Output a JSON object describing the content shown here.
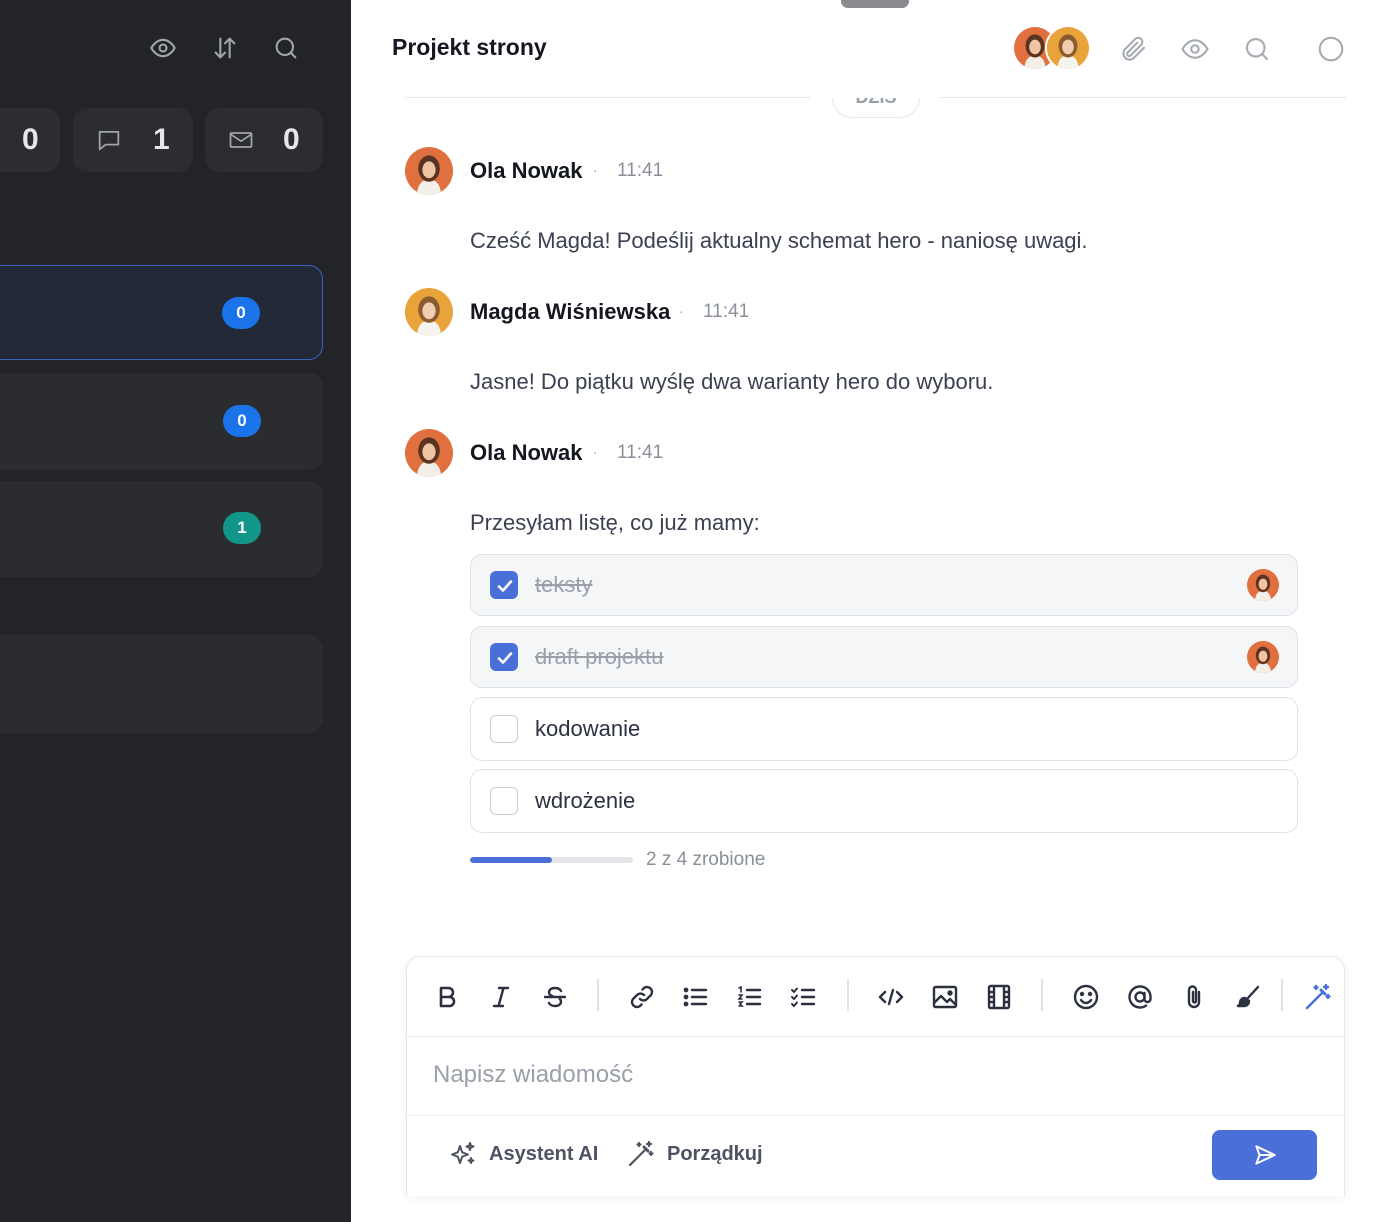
{
  "left_panel": {
    "counters": [
      {
        "icon": "unknown-icon",
        "value": "0"
      },
      {
        "icon": "comment-icon",
        "value": "1"
      },
      {
        "icon": "mail-icon",
        "value": "0"
      }
    ],
    "items": [
      {
        "badge": "0",
        "badge_color": "#1a73e8",
        "active": true
      },
      {
        "badge": "0",
        "badge_color": "#1a73e8",
        "active": false
      },
      {
        "badge": "1",
        "badge_color": "#12968a",
        "active": false
      },
      {
        "badge": "",
        "active": false
      }
    ]
  },
  "chat": {
    "title": "Projekt strony",
    "day_label": "DZIŚ",
    "messages": [
      {
        "author": "Ola Nowak",
        "time": "11:41",
        "text": "Cześć Magda! Podeślij aktualny schemat hero - naniosę uwagi."
      },
      {
        "author": "Magda Wiśniewska",
        "time": "11:41",
        "text": "Jasne! Do piątku wyślę dwa warianty hero do wyboru."
      },
      {
        "author": "Ola Nowak",
        "time": "11:41",
        "text": "Przesyłam listę, co już mamy:"
      }
    ],
    "checklist": [
      {
        "label": "teksty",
        "done": true
      },
      {
        "label": "draft projektu",
        "done": true
      },
      {
        "label": "kodowanie",
        "done": false
      },
      {
        "label": "wdrożenie",
        "done": false
      }
    ],
    "progress": {
      "done": 2,
      "total": 4,
      "fraction": 0.5,
      "text": "2 z 4 zrobione"
    }
  },
  "composer": {
    "placeholder": "Napisz wiadomość",
    "ai_label": "Asystent AI",
    "tidy_label": "Porządkuj"
  },
  "colors": {
    "accent": "#4a6fd8",
    "dark_bg": "#232427",
    "badge_blue": "#1a73e8",
    "badge_teal": "#12968a"
  }
}
